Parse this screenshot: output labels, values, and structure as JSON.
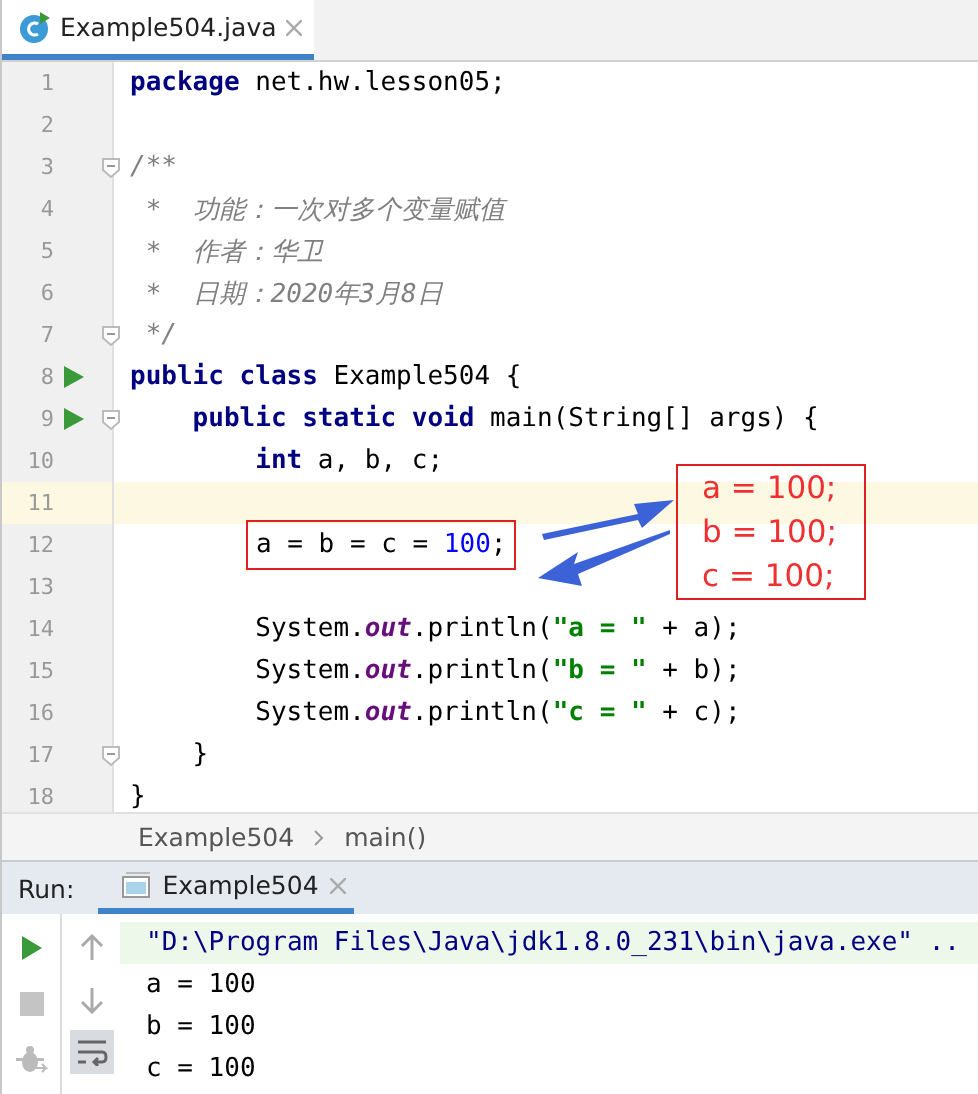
{
  "editor_tab": {
    "title": "Example504.java",
    "selected": true
  },
  "lines": [
    {
      "number": "1",
      "tokens": [
        {
          "text": "package",
          "kind": "keyword"
        },
        {
          "text": " net.hw.lesson05;",
          "kind": "plain"
        }
      ]
    },
    {
      "number": "2"
    },
    {
      "number": "3",
      "fold": true,
      "tokens": [
        {
          "text": "/**",
          "kind": "comment"
        }
      ]
    },
    {
      "number": "4",
      "tokens": [
        {
          "text": " *  功能：一次对多个变量赋值",
          "kind": "comment"
        }
      ]
    },
    {
      "number": "5",
      "tokens": [
        {
          "text": " *  作者：华卫",
          "kind": "comment"
        }
      ]
    },
    {
      "number": "6",
      "tokens": [
        {
          "text": " *  日期：2020年3月8日",
          "kind": "comment"
        }
      ]
    },
    {
      "number": "7",
      "fold": true,
      "tokens": [
        {
          "text": " */",
          "kind": "comment"
        }
      ]
    },
    {
      "number": "8",
      "run": true,
      "tokens": [
        {
          "text": "public class",
          "kind": "keyword"
        },
        {
          "text": " Example504 {",
          "kind": "plain"
        }
      ]
    },
    {
      "number": "9",
      "run": true,
      "fold": true,
      "tokens": [
        {
          "text": "    public static void",
          "kind": "keyword"
        },
        {
          "text": " main(String[] args) {",
          "kind": "plain"
        }
      ]
    },
    {
      "number": "10",
      "tokens": [
        {
          "text": "        int",
          "kind": "keyword"
        },
        {
          "text": " a, b, c;",
          "kind": "plain"
        }
      ]
    },
    {
      "number": "11",
      "current": true
    },
    {
      "number": "12",
      "boxed": true,
      "tokens": [
        {
          "text": "a = b = c = ",
          "kind": "plain"
        },
        {
          "text": "100",
          "kind": "number"
        },
        {
          "text": ";",
          "kind": "plain"
        }
      ]
    },
    {
      "number": "13"
    },
    {
      "number": "14",
      "tokens": [
        {
          "text": "        System.",
          "kind": "plain"
        },
        {
          "text": "out",
          "kind": "field"
        },
        {
          "text": ".println(",
          "kind": "plain"
        },
        {
          "text": "\"a = \"",
          "kind": "string"
        },
        {
          "text": " + a);",
          "kind": "plain"
        }
      ]
    },
    {
      "number": "15",
      "tokens": [
        {
          "text": "        System.",
          "kind": "plain"
        },
        {
          "text": "out",
          "kind": "field"
        },
        {
          "text": ".println(",
          "kind": "plain"
        },
        {
          "text": "\"b = \"",
          "kind": "string"
        },
        {
          "text": " + b);",
          "kind": "plain"
        }
      ]
    },
    {
      "number": "16",
      "tokens": [
        {
          "text": "        System.",
          "kind": "plain"
        },
        {
          "text": "out",
          "kind": "field"
        },
        {
          "text": ".println(",
          "kind": "plain"
        },
        {
          "text": "\"c = \"",
          "kind": "string"
        },
        {
          "text": " + c);",
          "kind": "plain"
        }
      ]
    },
    {
      "number": "17",
      "fold": true,
      "tokens": [
        {
          "text": "    }",
          "kind": "plain"
        }
      ]
    },
    {
      "number": "18",
      "tokens": [
        {
          "text": "}",
          "kind": "plain"
        }
      ]
    }
  ],
  "annotation": {
    "lines": [
      "a = 100;",
      "b = 100;",
      "c = 100;"
    ]
  },
  "breadcrumbs": [
    "Example504",
    "main()"
  ],
  "run_panel": {
    "label": "Run:",
    "tab": {
      "title": "Example504",
      "selected": true
    },
    "tools": [
      {
        "kind": "run",
        "disabled": false
      },
      {
        "kind": "stop",
        "disabled": true
      },
      {
        "kind": "debug",
        "disabled": true
      }
    ],
    "nav": [
      {
        "kind": "up",
        "selected": false
      },
      {
        "kind": "down",
        "selected": false
      },
      {
        "kind": "wrap",
        "selected": true
      }
    ],
    "output": [
      {
        "text": "\"D:\\Program Files\\Java\\jdk1.8.0_231\\bin\\java.exe\" ..",
        "kind": "command"
      },
      {
        "text": "a = 100",
        "kind": "out"
      },
      {
        "text": "b = 100",
        "kind": "out"
      },
      {
        "text": "c = 100",
        "kind": "out"
      }
    ]
  }
}
